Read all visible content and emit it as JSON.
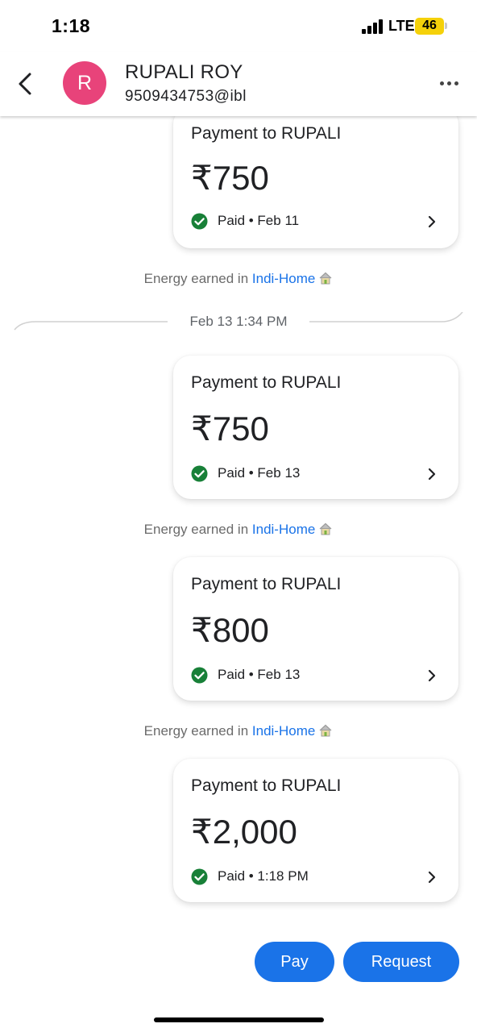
{
  "status_bar": {
    "time": "1:18",
    "network": "LTE",
    "battery": "46"
  },
  "header": {
    "avatar_letter": "R",
    "contact_name": "RUPALI ROY",
    "upi_id": "9509434753@ibl",
    "avatar_color": "#e8437a"
  },
  "date_separator": "Feb 13 1:34 PM",
  "energy": {
    "prefix": "Energy earned in",
    "link": "Indi-Home"
  },
  "payments": [
    {
      "title": "Payment to RUPALI",
      "amount": "₹750",
      "status": "Paid • Feb 11"
    },
    {
      "title": "Payment to RUPALI",
      "amount": "₹750",
      "status": "Paid • Feb 13"
    },
    {
      "title": "Payment to RUPALI",
      "amount": "₹800",
      "status": "Paid • Feb 13"
    },
    {
      "title": "Payment to RUPALI",
      "amount": "₹2,000",
      "status": "Paid • 1:18 PM"
    }
  ],
  "actions": {
    "pay": "Pay",
    "request": "Request"
  },
  "icons": [
    "back-arrow-icon",
    "more-icon",
    "check-circle-icon",
    "chevron-right-icon",
    "house-icon",
    "signal-icon",
    "battery-icon"
  ],
  "colors": {
    "accent": "#1a73e8",
    "paid_green": "#188038"
  }
}
